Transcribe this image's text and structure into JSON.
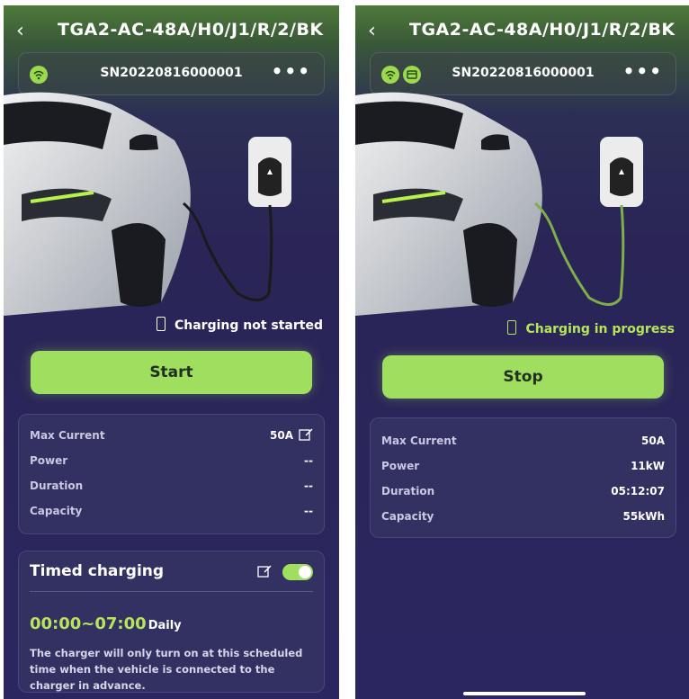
{
  "screens": [
    {
      "title": "TGA2-AC-48A/H0/J1/R/2/BK",
      "serial": "SN20220816000001",
      "status_text": "Charging not started",
      "primary_button": "Start",
      "rows": [
        {
          "label": "Max Current",
          "value": "50A"
        },
        {
          "label": "Power",
          "value": "--"
        },
        {
          "label": "Duration",
          "value": "--"
        },
        {
          "label": "Capacity",
          "value": "--"
        }
      ],
      "timed": {
        "title": "Timed charging",
        "enabled": true,
        "time_range": "00:00~07:00",
        "repeat": "Daily",
        "description": "The charger will only turn on at this scheduled time when the vehicle is connected to the charger in advance."
      }
    },
    {
      "title": "TGA2-AC-48A/H0/J1/R/2/BK",
      "serial": "SN20220816000001",
      "status_text": "Charging in progress",
      "primary_button": "Stop",
      "rows": [
        {
          "label": "Max Current",
          "value": "50A"
        },
        {
          "label": "Power",
          "value": "11kW"
        },
        {
          "label": "Duration",
          "value": "05:12:07"
        },
        {
          "label": "Capacity",
          "value": "55kWh"
        }
      ]
    }
  ],
  "colors": {
    "accent_green": "#9fde5e",
    "status_active": "#b6e45a",
    "background": "#2a2556"
  },
  "icons": {
    "back": "‹",
    "more": "•••",
    "edit": "edit-icon",
    "wifi": "wifi-icon",
    "battery": "battery-icon"
  }
}
